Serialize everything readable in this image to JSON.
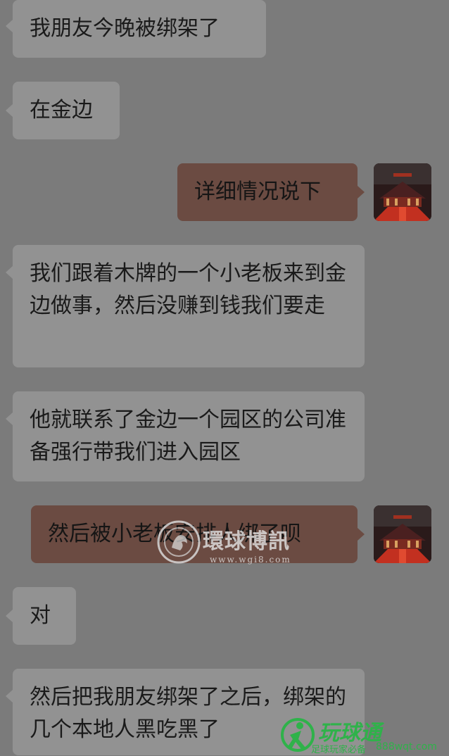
{
  "messages": [
    {
      "side": "in",
      "text": "我朋友今晚被绑架了"
    },
    {
      "side": "in",
      "text": "在金边"
    },
    {
      "side": "out",
      "text": "详细情况说下",
      "avatar": "palace-avatar-icon"
    },
    {
      "side": "in",
      "text": "我们跟着木牌的一个小老板来到金边做事，然后没赚到钱我们要走"
    },
    {
      "side": "in",
      "text": "他就联系了金边一个园区的公司准备强行带我们进入园区"
    },
    {
      "side": "out",
      "text": "然后被小老板安排人绑了呗",
      "avatar": "palace-avatar-icon"
    },
    {
      "side": "in",
      "text": "对"
    },
    {
      "side": "in",
      "text": "然后把我朋友绑架了之后，绑架的几个本地人黑吃黑了"
    }
  ],
  "watermarks": {
    "center": {
      "title": "環球博訊",
      "url": "www.wgi8.com",
      "logo": "lion-seal-icon"
    },
    "corner": {
      "title": "玩球通",
      "subtitle": "足球玩家必备",
      "url": "888wqt.com",
      "logo": "football-player-icon"
    }
  },
  "colors": {
    "background": "#7b7b7b",
    "incoming_bubble": "#929292",
    "outgoing_bubble": "#6b4b42",
    "corner_watermark": "#2fb24a"
  }
}
